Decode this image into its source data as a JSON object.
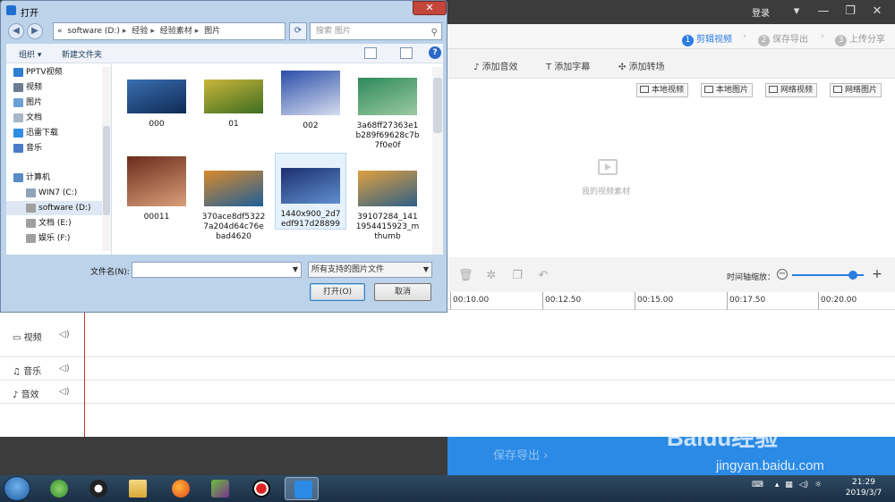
{
  "editor": {
    "login": "登录",
    "steps": [
      {
        "num": "1",
        "label": "剪辑视频"
      },
      {
        "num": "2",
        "label": "保存导出"
      },
      {
        "num": "3",
        "label": "上传分享"
      }
    ],
    "tools": [
      "添加音效",
      "添加字幕",
      "添加转场"
    ],
    "sources": [
      "本地视频",
      "本地图片",
      "网络视频",
      "网络图片"
    ],
    "empty_label": "我的视频素材",
    "zoom_label": "时间轴缩放：",
    "zoom_level": 0.85,
    "ruler": [
      "00:10.00",
      "00:12.50",
      "00:15.00",
      "00:17.50",
      "00:20.00"
    ],
    "tracks": [
      "视频",
      "音乐",
      "音效"
    ],
    "export": "保存导出"
  },
  "dialog": {
    "title": "打开",
    "path": [
      "software (D:)",
      "经验",
      "经验素材",
      "图片"
    ],
    "path_prefix": "«",
    "search_placeholder": "搜索 图片",
    "organize": "组织 ▾",
    "new_folder": "新建文件夹",
    "nav": [
      {
        "label": "PPTV视频",
        "color": "#2f7fd3"
      },
      {
        "label": "视频",
        "color": "#6c7d91"
      },
      {
        "label": "图片",
        "color": "#6c9fd4"
      },
      {
        "label": "文档",
        "color": "#a8b7c7"
      },
      {
        "label": "迅雷下载",
        "color": "#2f8de4"
      },
      {
        "label": "音乐",
        "color": "#4b7ac8"
      },
      {
        "label": "计算机",
        "color": "#5a8bc4"
      },
      {
        "label": "WIN7 (C:)",
        "color": "#8fa4b8"
      },
      {
        "label": "software (D:)",
        "color": "#a0a0a0"
      },
      {
        "label": "文档 (E:)",
        "color": "#a0a0a0"
      },
      {
        "label": "娱乐 (F:)",
        "color": "#a0a0a0"
      }
    ],
    "files": [
      {
        "name": "000",
        "c1": "#3a6fb0",
        "c2": "#0f2a55"
      },
      {
        "name": "01",
        "c1": "#c9b53a",
        "c2": "#3e6d21"
      },
      {
        "name": "002",
        "c1": "#2b4fa8",
        "c2": "#d6dcef"
      },
      {
        "name": "3a68ff27363e1b289f69628c7b7f0e0f",
        "c1": "#2e8a5c",
        "c2": "#9bc9a0"
      },
      {
        "name": "00011",
        "c1": "#6b2b1b",
        "c2": "#d9a07a"
      },
      {
        "name": "370ace8df53227a204d64c76ebad4620",
        "c1": "#d98a2b",
        "c2": "#1f5f9a"
      },
      {
        "name": "1440x900_2d7edf917d28899",
        "c1": "#1c2f6e",
        "c2": "#5f8fd0"
      },
      {
        "name": "39107284_1411954415923_mthumb",
        "c1": "#e0a040",
        "c2": "#2e5f86"
      }
    ],
    "filename_label": "文件名(N):",
    "filename_value": "",
    "filetype": "所有支持的图片文件",
    "open": "打开(O)",
    "cancel": "取消"
  },
  "taskbar": {
    "time": "21:29",
    "date": "2019/3/7"
  },
  "watermark": {
    "brand": "Baidu经验",
    "url": "jingyan.baidu.com"
  }
}
